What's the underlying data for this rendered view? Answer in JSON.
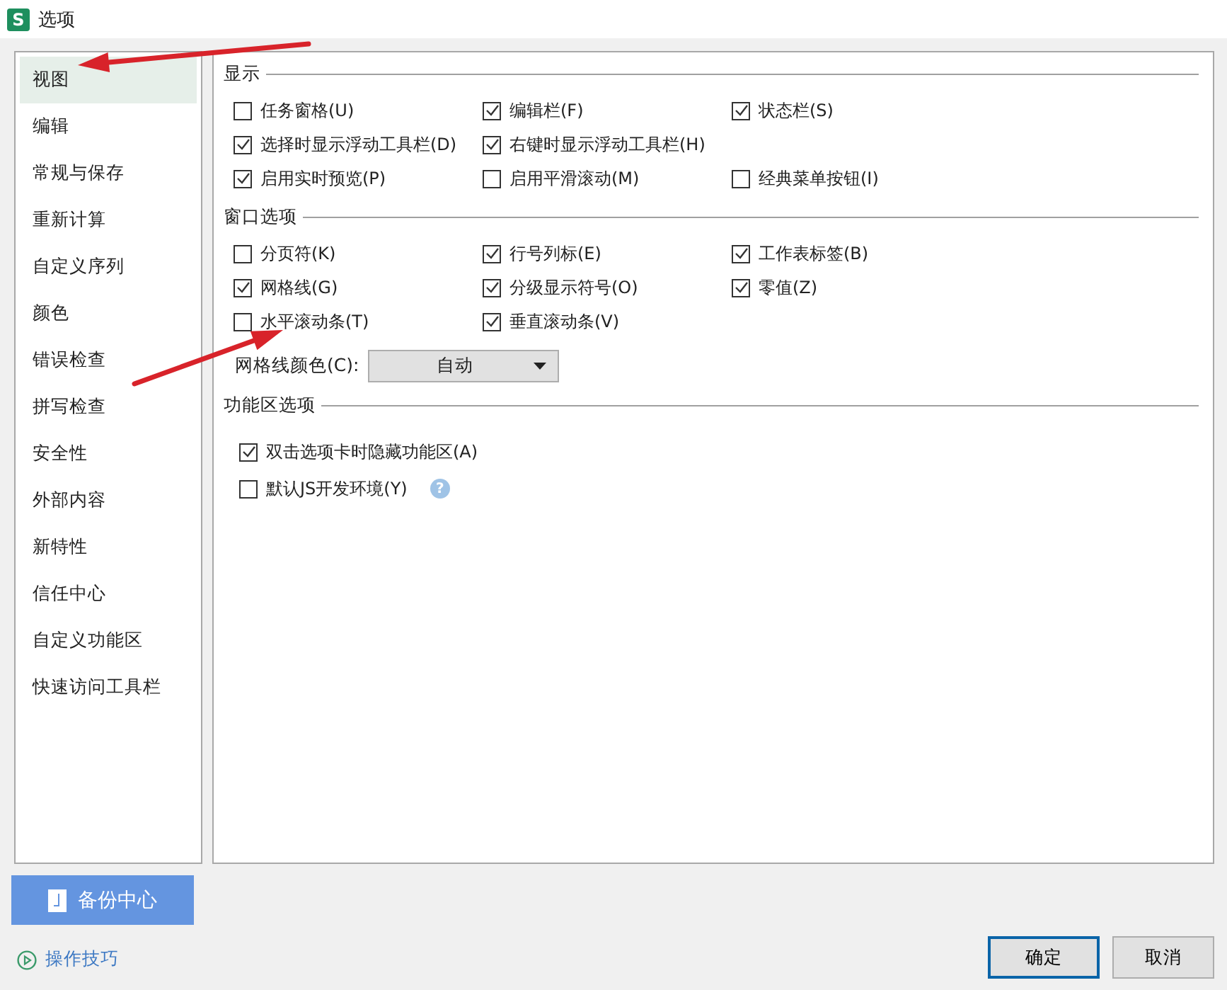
{
  "window": {
    "title": "选项",
    "app_icon": "S"
  },
  "sidebar": {
    "items": [
      {
        "label": "视图",
        "selected": true
      },
      {
        "label": "编辑",
        "selected": false
      },
      {
        "label": "常规与保存",
        "selected": false
      },
      {
        "label": "重新计算",
        "selected": false
      },
      {
        "label": "自定义序列",
        "selected": false
      },
      {
        "label": "颜色",
        "selected": false
      },
      {
        "label": "错误检查",
        "selected": false
      },
      {
        "label": "拼写检查",
        "selected": false
      },
      {
        "label": "安全性",
        "selected": false
      },
      {
        "label": "外部内容",
        "selected": false
      },
      {
        "label": "新特性",
        "selected": false
      },
      {
        "label": "信任中心",
        "selected": false
      },
      {
        "label": "自定义功能区",
        "selected": false
      },
      {
        "label": "快速访问工具栏",
        "selected": false
      }
    ]
  },
  "sections": [
    {
      "title": "显示",
      "kind": "grid",
      "rows": [
        [
          {
            "label": "任务窗格(U)",
            "checked": false
          },
          {
            "label": "编辑栏(F)",
            "checked": true
          },
          {
            "label": "状态栏(S)",
            "checked": true
          }
        ],
        [
          {
            "label": "选择时显示浮动工具栏(D)",
            "checked": true
          },
          {
            "label": "右键时显示浮动工具栏(H)",
            "checked": true
          }
        ],
        [
          {
            "label": "启用实时预览(P)",
            "checked": true
          },
          {
            "label": "启用平滑滚动(M)",
            "checked": false
          },
          {
            "label": "经典菜单按钮(I)",
            "checked": false
          }
        ]
      ]
    },
    {
      "title": "窗口选项",
      "kind": "grid",
      "rows": [
        [
          {
            "label": "分页符(K)",
            "checked": false
          },
          {
            "label": "行号列标(E)",
            "checked": true
          },
          {
            "label": "工作表标签(B)",
            "checked": true
          }
        ],
        [
          {
            "label": "网格线(G)",
            "checked": true
          },
          {
            "label": "分级显示符号(O)",
            "checked": true
          },
          {
            "label": "零值(Z)",
            "checked": true
          }
        ],
        [
          {
            "label": "水平滚动条(T)",
            "checked": false
          },
          {
            "label": "垂直滚动条(V)",
            "checked": true
          }
        ]
      ],
      "dropdown": {
        "label": "网格线颜色(C):",
        "value": "自动"
      }
    },
    {
      "title": "功能区选项",
      "kind": "list",
      "rows": [
        [
          {
            "label": "双击选项卡时隐藏功能区(A)",
            "checked": true
          }
        ],
        [
          {
            "label": "默认JS开发环境(Y)",
            "checked": false,
            "help": "?"
          }
        ]
      ]
    }
  ],
  "backup_button": "备份中心",
  "tips_link": "操作技巧",
  "buttons": [
    {
      "label": "确定",
      "default": true
    },
    {
      "label": "取消",
      "default": false
    }
  ]
}
